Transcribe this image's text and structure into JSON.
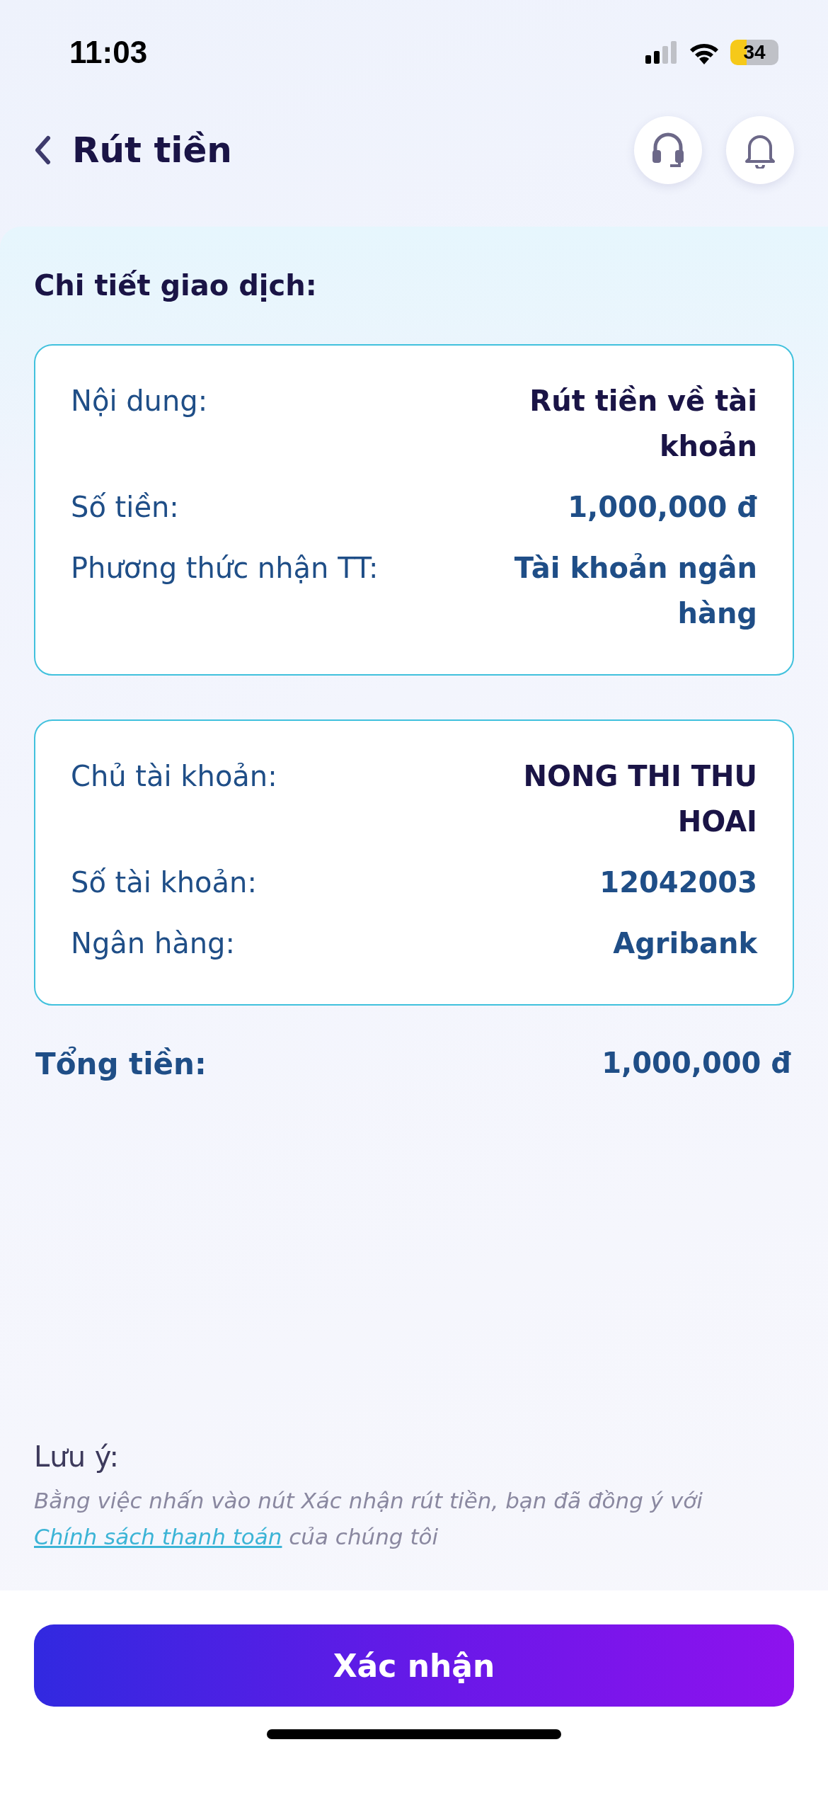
{
  "status_bar": {
    "time": "11:03",
    "battery": "34"
  },
  "header": {
    "title": "Rút tiền"
  },
  "section_title": "Chi tiết giao dịch:",
  "cards": [
    {
      "rows": [
        {
          "label": "Nội dung:",
          "value": "Rút tiền về tài khoản",
          "color": "#1a1446"
        },
        {
          "label": "Số tiền:",
          "value": "1,000,000 đ",
          "color": "#1f4e87"
        },
        {
          "label": "Phương thức nhận TT:",
          "value": "Tài khoản ngân hàng",
          "color": "#1f4e87"
        }
      ]
    },
    {
      "rows": [
        {
          "label": "Chủ tài khoản:",
          "value": "NONG THI THU HOAI",
          "color": "#1a1446"
        },
        {
          "label": "Số tài khoản:",
          "value": "12042003",
          "color": "#1f4e87"
        },
        {
          "label": "Ngân hàng:",
          "value": "Agribank",
          "color": "#1f4e87"
        }
      ]
    }
  ],
  "total": {
    "label": "Tổng tiền:",
    "value": "1,000,000 đ"
  },
  "note": {
    "title": "Lưu ý:",
    "text_before": "Bằng việc nhấn vào nút Xác nhận rút tiền, bạn đã đồng ý với",
    "link": "Chính sách thanh toán",
    "text_after": "của chúng tôi"
  },
  "confirm_button": "Xác nhận"
}
